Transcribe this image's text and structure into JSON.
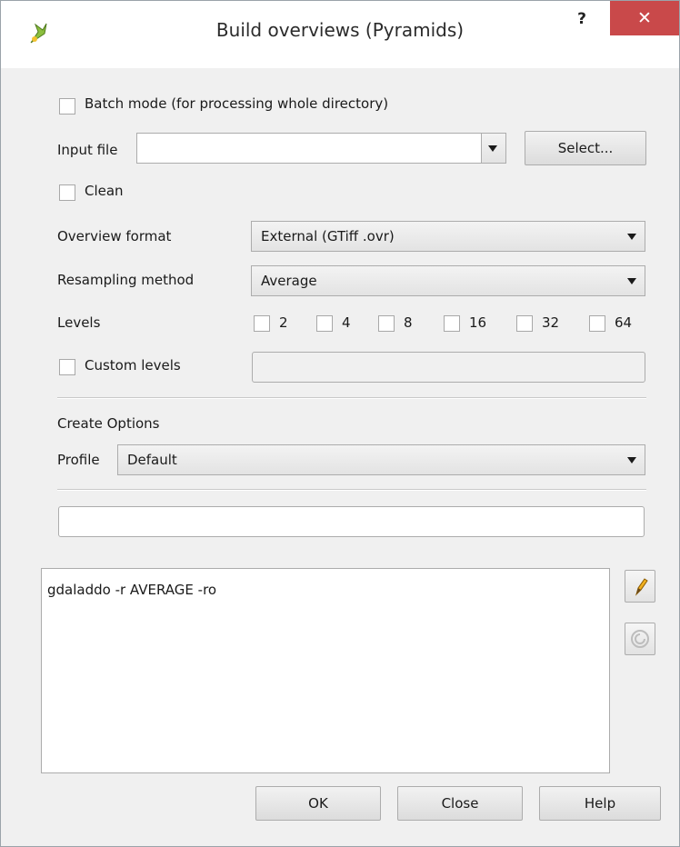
{
  "window": {
    "title": "Build overviews (Pyramids)",
    "help_label": "?",
    "close_label": "✕"
  },
  "batch_mode": {
    "label": "Batch mode (for processing whole directory)",
    "checked": false
  },
  "input_file": {
    "label": "Input file",
    "value": "",
    "select_label": "Select..."
  },
  "clean": {
    "label": "Clean",
    "checked": false
  },
  "overview_format": {
    "label": "Overview format",
    "value": "External (GTiff .ovr)"
  },
  "resampling_method": {
    "label": "Resampling method",
    "value": "Average"
  },
  "levels": {
    "label": "Levels",
    "options": [
      "2",
      "4",
      "8",
      "16",
      "32",
      "64"
    ]
  },
  "custom_levels": {
    "label": "Custom levels",
    "value": ""
  },
  "create_options": {
    "heading": "Create Options",
    "profile_label": "Profile",
    "profile_value": "Default",
    "options_value": ""
  },
  "command": {
    "text": "gdaladdo -r AVERAGE -ro"
  },
  "buttons": {
    "ok": "OK",
    "close": "Close",
    "help": "Help"
  }
}
